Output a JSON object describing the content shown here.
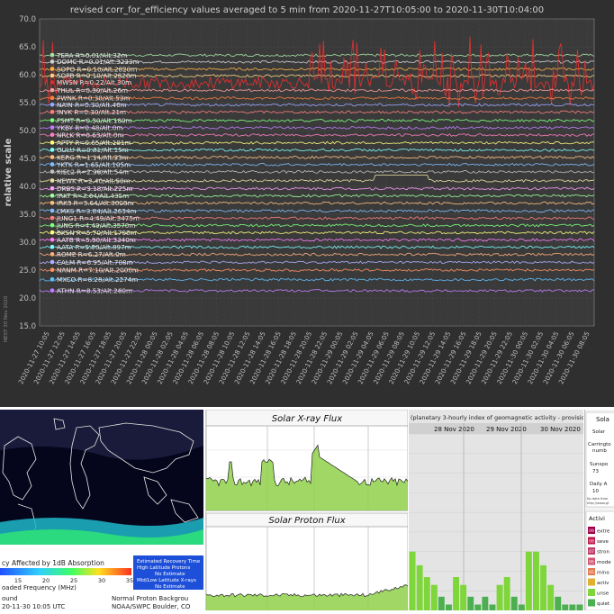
{
  "main_chart": {
    "title": "revised corr_for_efficiency values averaged to 5 min from 2020-11-27T10:05:00 to 2020-11-30T10:04:00",
    "ylabel": "relative scale",
    "watermark": "NEST 30 Nov 2020",
    "bg_color": "#2f2f2f",
    "plot_color": "#3a3a3a"
  },
  "chart_data": [
    {
      "type": "line",
      "title": "revised corr_for_efficiency values averaged to 5 min from 2020-11-27T10:05:00 to 2020-11-30T10:04:00",
      "ylabel": "relative scale",
      "ylim": [
        15.0,
        70.0
      ],
      "yticks": [
        "15.0",
        "20.0",
        "25.0",
        "30.0",
        "35.0",
        "40.0",
        "45.0",
        "50.0",
        "55.0",
        "60.0",
        "65.0",
        "70.0"
      ],
      "xticks": [
        "2020-11-27 10:05",
        "2020-11-27 12:05",
        "2020-11-27 14:05",
        "2020-11-27 16:05",
        "2020-11-27 18:05",
        "2020-11-27 20:05",
        "2020-11-27 22:05",
        "2020-11-28 00:05",
        "2020-11-28 02:05",
        "2020-11-28 04:05",
        "2020-11-28 06:05",
        "2020-11-28 08:05",
        "2020-11-28 10:05",
        "2020-11-28 12:05",
        "2020-11-28 14:05",
        "2020-11-28 16:05",
        "2020-11-28 18:05",
        "2020-11-28 20:05",
        "2020-11-28 22:05",
        "2020-11-29 00:05",
        "2020-11-29 02:05",
        "2020-11-29 04:05",
        "2020-11-29 06:05",
        "2020-11-29 08:05",
        "2020-11-29 10:05",
        "2020-11-29 12:05",
        "2020-11-29 14:05",
        "2020-11-29 16:05",
        "2020-11-29 18:05",
        "2020-11-29 20:05",
        "2020-11-29 22:05",
        "2020-11-30 00:05",
        "2020-11-30 02:05",
        "2020-11-30 04:05",
        "2020-11-30 06:05",
        "2020-11-30 08:05"
      ],
      "grid": true,
      "series": [
        {
          "name": "TERA R=0.01/Alt.32m",
          "baseline": 63.5,
          "color": "#a6e3a6"
        },
        {
          "name": "DOMC R=0.01/Alt.3233m",
          "baseline": 62.3,
          "color": "#d0d0d0"
        },
        {
          "name": "SOPO R=0.10/Alt.2820m",
          "baseline": 61.0,
          "color": "#ffb347"
        },
        {
          "name": "SOPB R=0.10/Alt.2820m",
          "baseline": 59.8,
          "color": "#ffd27f"
        },
        {
          "name": "MWSN R=0.22/Alt.30m",
          "baseline": 58.6,
          "color": "#e03030"
        },
        {
          "name": "THUL R=0.30/Alt.26m",
          "baseline": 57.2,
          "color": "#ff9f9f"
        },
        {
          "name": "PWNK R=0.30/Alt.53m",
          "baseline": 55.8,
          "color": "#ff8040"
        },
        {
          "name": "NAIN R=0.30/Alt.46m",
          "baseline": 54.6,
          "color": "#9fa8ff"
        },
        {
          "name": "INVK R=0.30/Alt.21m",
          "baseline": 53.3,
          "color": "#ff7f7f"
        },
        {
          "name": "FSMT R=0.30/Alt.180m",
          "baseline": 51.8,
          "color": "#7fff7f"
        },
        {
          "name": "YKBY R=0.48/Alt.0m",
          "baseline": 50.5,
          "color": "#bf7fff"
        },
        {
          "name": "NRLK R=0.63/Alt.0m",
          "baseline": 49.2,
          "color": "#ff7fbf"
        },
        {
          "name": "APTY R=0.65/Alt.181m",
          "baseline": 47.8,
          "color": "#ffff7f"
        },
        {
          "name": "OULU R=0.81/Alt.15m",
          "baseline": 46.5,
          "color": "#7fffff"
        },
        {
          "name": "KERG R=1.14/Alt.33m",
          "baseline": 45.2,
          "color": "#ffbf7f"
        },
        {
          "name": "YKTK R=1.65/Alt.105m",
          "baseline": 43.9,
          "color": "#7fbfff"
        },
        {
          "name": "KIEL2 R=2.36/Alt.54m",
          "baseline": 42.6,
          "color": "#c0c0c0"
        },
        {
          "name": "NEWK R=2.40/Alt.50m",
          "baseline": 41.0,
          "color": "#e8e0a0"
        },
        {
          "name": "DRBS R=3.18/Alt.225m",
          "baseline": 39.6,
          "color": "#ffa0ff"
        },
        {
          "name": "IRKT R=3.64/Alt.435m",
          "baseline": 38.3,
          "color": "#a0ffa0"
        },
        {
          "name": "IRK3 R=3.64/Alt.3000m",
          "baseline": 37.0,
          "color": "#ffc080"
        },
        {
          "name": "LMKS R=3.84/Alt.2634m",
          "baseline": 35.6,
          "color": "#80c0ff"
        },
        {
          "name": "JUNG1 R=4.49/Alt.3475m",
          "baseline": 34.3,
          "color": "#ff8080"
        },
        {
          "name": "JUNG R=4.49/Alt.3570m",
          "baseline": 33.0,
          "color": "#80ff80"
        },
        {
          "name": "BKSN R=5.70/Alt.1700m",
          "baseline": 31.7,
          "color": "#ffff80"
        },
        {
          "name": "AATB R=5.90/Alt.3340m",
          "baseline": 30.4,
          "color": "#ff80ff"
        },
        {
          "name": "AATA R=5.90/Alt.897m",
          "baseline": 29.1,
          "color": "#80ffff"
        },
        {
          "name": "ROME R=6.27/Alt.0m",
          "baseline": 27.8,
          "color": "#ffb080"
        },
        {
          "name": "CALM R=6.95/Alt.708m",
          "baseline": 26.4,
          "color": "#b0b0ff"
        },
        {
          "name": "NANM R=7.10/Alt.2000m",
          "baseline": 25.0,
          "color": "#ff9060"
        },
        {
          "name": "MXCO R=8.28/Alt.2274m",
          "baseline": 23.3,
          "color": "#60c0ff"
        },
        {
          "name": "ATHN R=8.53/Alt.260m",
          "baseline": 21.3,
          "color": "#c080ff"
        }
      ]
    },
    {
      "type": "line",
      "title": "Solar X-ray Flux"
    },
    {
      "type": "line",
      "title": "Solar Proton Flux"
    },
    {
      "type": "bar",
      "title": "(planetary 3-hourly index of geomagnetic activity - provisional data)",
      "categories": [
        "28 Nov 2020",
        "29 Nov 2020",
        "30 Nov 2020"
      ],
      "values": [
        3.0,
        2.3,
        1.7,
        1.3,
        0.7,
        0.3,
        1.7,
        1.3,
        0.7,
        0.3,
        0.7,
        0.3,
        1.3,
        1.7,
        0.7,
        0.3,
        3.0,
        3.0,
        2.3,
        1.3,
        0.7,
        0.3,
        0.3,
        0.3
      ],
      "colors": [
        "#7ed63a",
        "#7ed63a",
        "#7ed63a",
        "#7ed63a",
        "#4caf50",
        "#4caf50",
        "#7ed63a",
        "#7ed63a",
        "#4caf50",
        "#4caf50",
        "#4caf50",
        "#4caf50",
        "#7ed63a",
        "#7ed63a",
        "#4caf50",
        "#4caf50",
        "#7ed63a",
        "#7ed63a",
        "#7ed63a",
        "#7ed63a",
        "#4caf50",
        "#4caf50",
        "#4caf50",
        "#4caf50"
      ]
    }
  ],
  "dellinger": {
    "scale_title": "cy Affected by 1dB Absorption",
    "scale_ticks": [
      "15",
      "20",
      "25",
      "30",
      "35"
    ],
    "scale_sub": "oaded Frequency (MHz)",
    "status_box": [
      "Estimated Recovery Time",
      "High Latitude Protons",
      "No Estimate",
      "Mid/Low Latitude X-rays",
      "No Estimate"
    ],
    "footer_left_1": "ound",
    "footer_left_2": "20-11-30 10:05 UTC",
    "footer_right_1": "Normal Proton Backgrou",
    "footer_right_2": "NOAA/SWPC Boulder, CO"
  },
  "xray": {
    "title": "Solar X-ray Flux"
  },
  "proton": {
    "title": "Solar Proton Flux"
  },
  "kp": {
    "caption": "(planetary 3-hourly index of geomagnetic activity - provisional data)",
    "days": [
      "28 Nov 2020",
      "29 Nov 2020",
      "30 Nov 2020"
    ]
  },
  "sidepanel": {
    "title_1": "Sola",
    "solar_label": "Solar",
    "carrington_1": "Carringto",
    "carrington_2": "numb",
    "sunspot_1": "Sunspo",
    "sunspot_2": "73",
    "daily_1": "Daily A",
    "daily_2": "10",
    "source_1": "Kp data from",
    "source_2": "http://www.gf",
    "activity_title": "Activi",
    "levels": [
      {
        "badge": "09",
        "label": "extre",
        "color": "#a0004a"
      },
      {
        "badge": "08",
        "label": "seve",
        "color": "#c0144a"
      },
      {
        "badge": "07",
        "label": "stron",
        "color": "#c03c64"
      },
      {
        "badge": "06",
        "label": "mode",
        "color": "#d0506e"
      },
      {
        "badge": "05",
        "label": "mino",
        "color": "#e07850"
      },
      {
        "badge": "",
        "label": "activ",
        "color": "#e0b030"
      },
      {
        "badge": "",
        "label": "unse",
        "color": "#7ed63a"
      },
      {
        "badge": "",
        "label": "quiet",
        "color": "#4caf50"
      }
    ]
  }
}
